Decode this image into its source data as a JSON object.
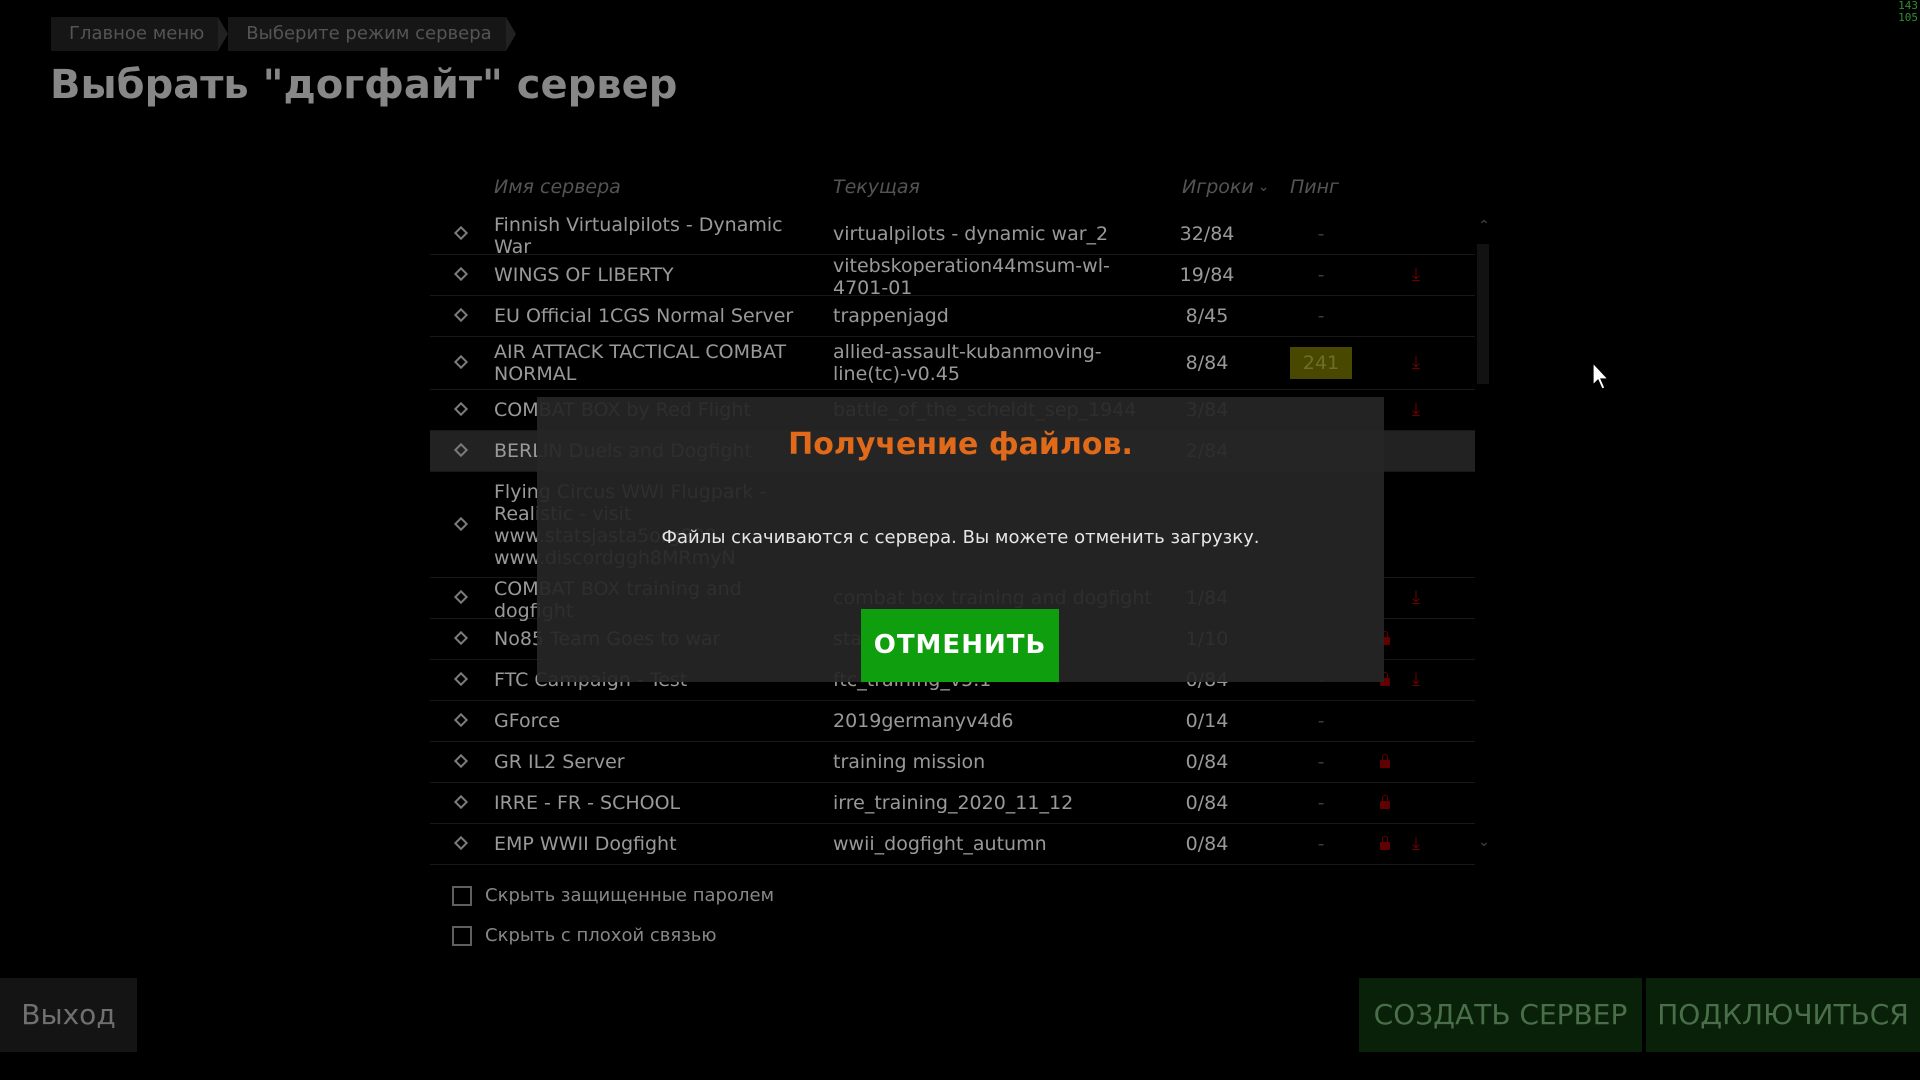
{
  "breadcrumb": [
    "Главное меню",
    "Выберите режим сервера"
  ],
  "page_title": "Выбрать \"догфайт\" сервер",
  "fps_overlay": [
    "143",
    "105"
  ],
  "table": {
    "headers": {
      "name": "Имя сервера",
      "current": "Текущая",
      "players": "Игроки",
      "ping": "Пинг"
    },
    "sort_indicator_icon": "chevron-down-icon",
    "rows": [
      {
        "name": "Finnish Virtualpilots - Dynamic War",
        "current": "virtualpilots - dynamic war_2",
        "players": "32/84",
        "ping": "-",
        "locked": false,
        "download": false
      },
      {
        "name": "WINGS OF LIBERTY",
        "current": "vitebskoperation44msum-wl-4701-01",
        "players": "19/84",
        "ping": "-",
        "locked": false,
        "download": true
      },
      {
        "name": "EU Official 1CGS Normal Server",
        "current": "trappenjagd",
        "players": "8/45",
        "ping": "-",
        "locked": false,
        "download": false
      },
      {
        "name": "AIR ATTACK TACTICAL COMBAT NORMAL",
        "current": "allied-assault-kubanmoving-line(tc)-v0.45",
        "players": "8/84",
        "ping": "241",
        "ping_badge": true,
        "locked": false,
        "download": true
      },
      {
        "name": "COMBAT BOX by Red Flight",
        "current": "battle_of_the_scheldt_sep_1944",
        "players": "3/84",
        "ping": "",
        "locked": false,
        "download": true
      },
      {
        "name": "BERLIN Duels and Dogfight",
        "current": "",
        "players": "2/84",
        "ping": "",
        "locked": false,
        "download": false,
        "selected": true
      },
      {
        "name": "Flying Circus WWI Flugpark - Realistic - visit www.statsjasta5org800 www.discordggh8MRmyN",
        "current": "",
        "players": "",
        "ping": "",
        "locked": false,
        "download": false
      },
      {
        "name": "COMBAT BOX training and dogfight",
        "current": "combat box training and dogfight",
        "players": "1/84",
        "ping": "",
        "locked": false,
        "download": true
      },
      {
        "name": "No85 Team Goes to war",
        "current": "stalingrad",
        "players": "1/10",
        "ping": "",
        "locked": true,
        "download": false
      },
      {
        "name": "FTC Campaign - Test",
        "current": "ftc_training_v5.1",
        "players": "0/84",
        "ping": "-",
        "locked": true,
        "download": true
      },
      {
        "name": "GForce",
        "current": "2019germanyv4d6",
        "players": "0/14",
        "ping": "-",
        "locked": false,
        "download": false
      },
      {
        "name": "GR IL2 Server",
        "current": "training mission",
        "players": "0/84",
        "ping": "-",
        "locked": true,
        "download": false
      },
      {
        "name": "IRRE - FR - SCHOOL",
        "current": "irre_training_2020_11_12",
        "players": "0/84",
        "ping": "-",
        "locked": true,
        "download": false
      },
      {
        "name": "EMP WWII Dogfight",
        "current": "wwii_dogfight_autumn",
        "players": "0/84",
        "ping": "-",
        "locked": true,
        "download": true
      }
    ]
  },
  "filters": {
    "hide_password": "Скрыть защищенные паролем",
    "hide_bad_connection": "Скрыть с плохой связью"
  },
  "footer": {
    "exit": "Выход",
    "create_server": "СОЗДАТЬ СЕРВЕР",
    "connect": "ПОДКЛЮЧИТЬСЯ"
  },
  "modal": {
    "title": "Получение файлов.",
    "message": "Файлы скачиваются с сервера. Вы можете отменить загрузку.",
    "cancel": "ОТМЕНИТЬ"
  },
  "colors": {
    "accent_orange": "#e06a1a",
    "cancel_green": "#0e9e0e",
    "footer_green": "#0b2a0b",
    "ping_badge": "#5c5a00",
    "icon_red": "#8a0000"
  }
}
